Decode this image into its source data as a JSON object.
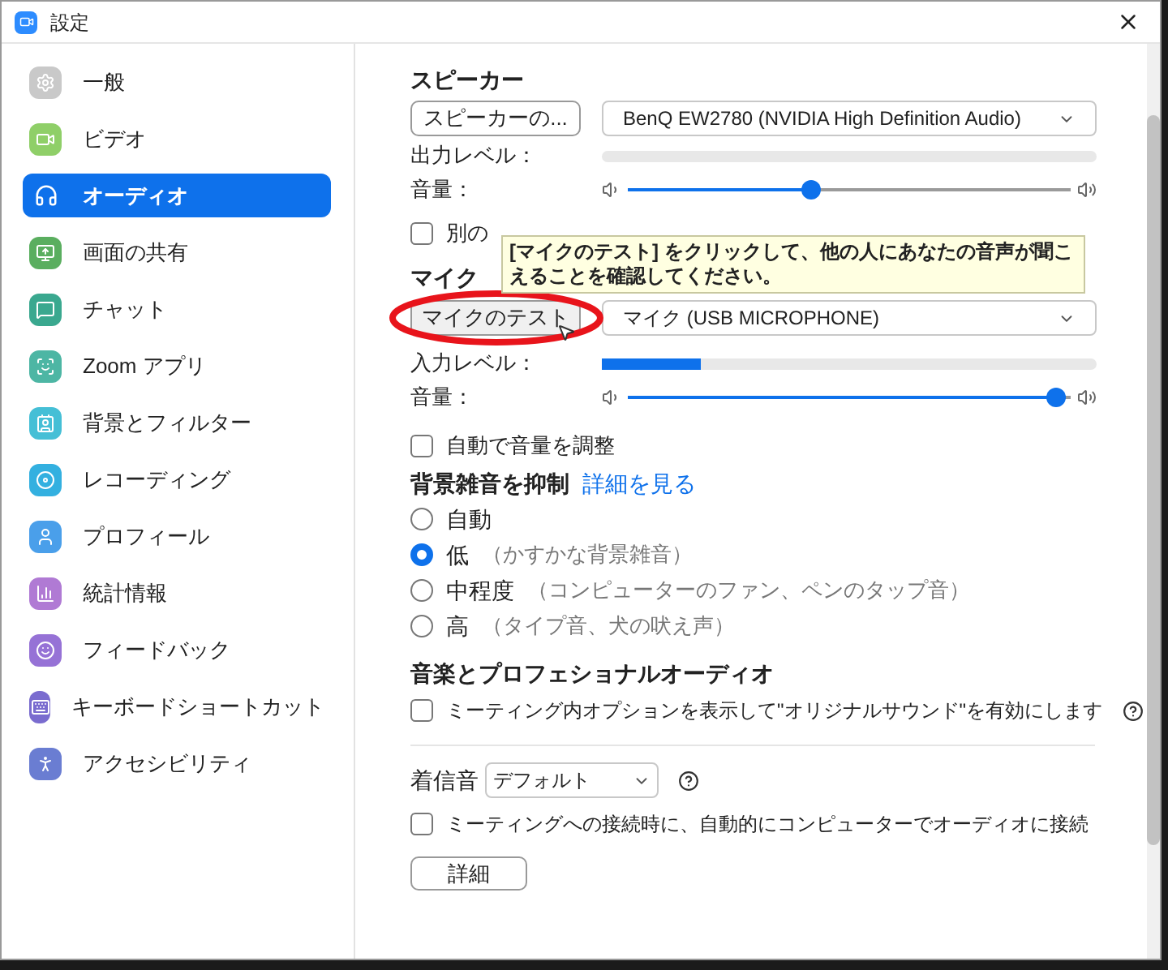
{
  "window": {
    "title": "設定"
  },
  "sidebar": {
    "items": [
      {
        "label": "一般",
        "selected": false,
        "color": "#c9c9c9"
      },
      {
        "label": "ビデオ",
        "selected": false,
        "color": "#8fcf68"
      },
      {
        "label": "オーディオ",
        "selected": true,
        "color": "#0e71eb"
      },
      {
        "label": "画面の共有",
        "selected": false,
        "color": "#5aae5f"
      },
      {
        "label": "チャット",
        "selected": false,
        "color": "#3aa88f"
      },
      {
        "label": "Zoom アプリ",
        "selected": false,
        "color": "#4db6a4"
      },
      {
        "label": "背景とフィルター",
        "selected": false,
        "color": "#45bfd6"
      },
      {
        "label": "レコーディング",
        "selected": false,
        "color": "#33b0e0"
      },
      {
        "label": "プロフィール",
        "selected": false,
        "color": "#4a9fea"
      },
      {
        "label": "統計情報",
        "selected": false,
        "color": "#b07ad4"
      },
      {
        "label": "フィードバック",
        "selected": false,
        "color": "#9672d6"
      },
      {
        "label": "キーボードショートカット",
        "selected": false,
        "color": "#7a6ccf"
      },
      {
        "label": "アクセシビリティ",
        "selected": false,
        "color": "#6a7dd2"
      }
    ]
  },
  "speaker": {
    "heading": "スピーカー",
    "test_button": "スピーカーの...",
    "device": "BenQ EW2780 (NVIDIA High Definition Audio)",
    "output_label": "出力レベル：",
    "volume_label": "音量：",
    "volume": {
      "level": 0.41
    },
    "ring_checkbox": {
      "label": "別の",
      "checked": false
    }
  },
  "tooltip": {
    "text": "[マイクのテスト] をクリックして、他の人にあなたの音声が聞こえることを確認してください。"
  },
  "mic": {
    "heading": "マイク",
    "test_button": "マイクのテスト",
    "device": "マイク (USB MICROPHONE)",
    "input_label": "入力レベル：",
    "input_level": {
      "level": 0.2
    },
    "volume_label": "音量：",
    "volume": {
      "level": 0.99
    },
    "auto_volume": {
      "label": "自動で音量を調整",
      "checked": false
    }
  },
  "noise": {
    "heading": "背景雑音を抑制",
    "link": "詳細を見る",
    "options": [
      {
        "label": "自動",
        "selected": false
      },
      {
        "label": "低",
        "note": "（かすかな背景雑音）",
        "selected": true
      },
      {
        "label": "中程度",
        "note": "（コンピューターのファン、ペンのタップ音）",
        "selected": false
      },
      {
        "label": "高",
        "note": "（タイプ音、犬の吠え声）",
        "selected": false
      }
    ]
  },
  "music": {
    "heading": "音楽とプロフェショナルオーディオ",
    "original_sound": {
      "label": "ミーティング内オプションを表示して\"オリジナルサウンド\"を有効にします",
      "checked": false
    }
  },
  "ringtone": {
    "label": "着信音",
    "value": "デフォルト"
  },
  "auto_join": {
    "label": "ミーティングへの接続時に、自動的にコンピューターでオーディオに接続",
    "checked": false
  },
  "advanced_button": "詳細"
}
